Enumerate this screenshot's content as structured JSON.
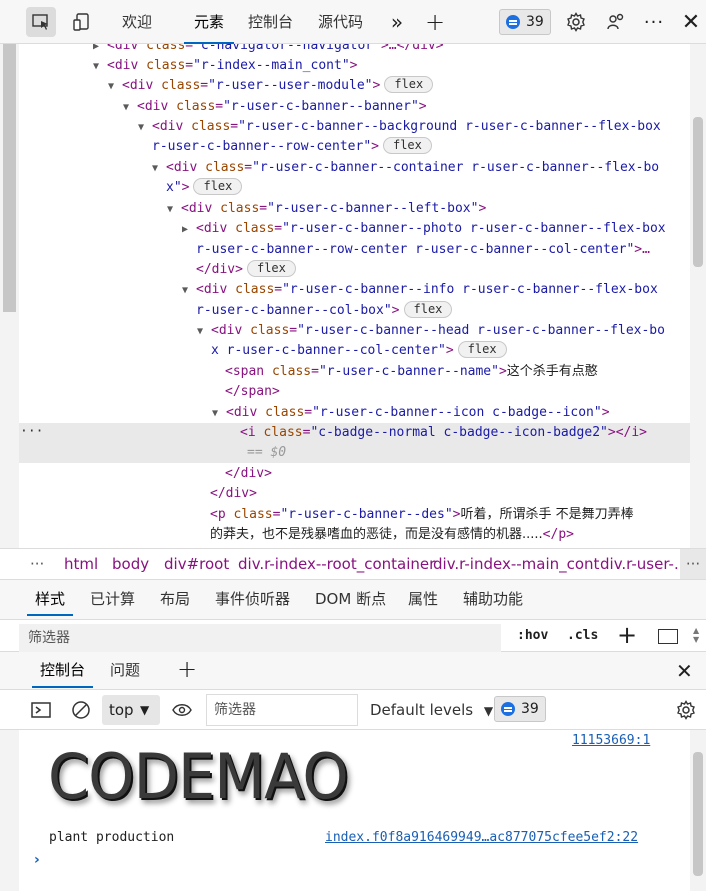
{
  "toolbar": {
    "tabs": [
      "欢迎",
      "元素",
      "控制台",
      "源代码"
    ],
    "active_tab": "元素",
    "issues_count": "39"
  },
  "dom_lines": {
    "l0": {
      "tag_open": "<div ",
      "attr": "class",
      "val": "\"c-navigator--navigator\"",
      "tail": ">…</div>"
    },
    "l1": {
      "tag_open": "<div ",
      "attr": "class",
      "val": "\"r-index--main_cont\"",
      "tail": ">"
    },
    "l2": {
      "tag_open": "<div ",
      "attr": "class",
      "val": "\"r-user--user-module\"",
      "tail": ">",
      "badge": "flex"
    },
    "l3": {
      "tag_open": "<div ",
      "attr": "class",
      "val": "\"r-user-c-banner--banner\"",
      "tail": ">"
    },
    "l4a": {
      "tag_open": "<div ",
      "attr": "class",
      "val": "\"r-user-c-banner--background r-user-c-banner--flex-box"
    },
    "l4b": {
      "val": "r-user-c-banner--row-center\"",
      "tail": ">",
      "badge": "flex"
    },
    "l5a": {
      "tag_open": "<div ",
      "attr": "class",
      "val": "\"r-user-c-banner--container r-user-c-banner--flex-bo"
    },
    "l5b": {
      "val": "x\"",
      "tail": ">",
      "badge": "flex"
    },
    "l6": {
      "tag_open": "<div ",
      "attr": "class",
      "val": "\"r-user-c-banner--left-box\"",
      "tail": ">"
    },
    "l7a": {
      "tag_open": "<div ",
      "attr": "class",
      "val": "\"r-user-c-banner--photo r-user-c-banner--flex-box"
    },
    "l7b": {
      "val": "r-user-c-banner--row-center r-user-c-banner--col-center\"",
      "tail": ">…"
    },
    "l7c": {
      "tail": "</div>",
      "badge": "flex"
    },
    "l8a": {
      "tag_open": "<div ",
      "attr": "class",
      "val": "\"r-user-c-banner--info r-user-c-banner--flex-box"
    },
    "l8b": {
      "val": "r-user-c-banner--col-box\"",
      "tail": ">",
      "badge": "flex"
    },
    "l9a": {
      "tag_open": "<div ",
      "attr": "class",
      "val": "\"r-user-c-banner--head r-user-c-banner--flex-bo"
    },
    "l9b": {
      "val": "x r-user-c-banner--col-center\"",
      "tail": ">",
      "badge": "flex"
    },
    "l10": {
      "tag_open": "<span ",
      "attr": "class",
      "val": "\"r-user-c-banner--name\"",
      "tail": ">",
      "text": "这个杀手有点憨"
    },
    "l11": {
      "tail": "</span>"
    },
    "l12": {
      "tag_open": "<div ",
      "attr": "class",
      "val": "\"r-user-c-banner--icon c-badge--icon\"",
      "tail": ">"
    },
    "l13": {
      "tag_open": "<i ",
      "attr": "class",
      "val": "\"c-badge--normal c-badge--icon-badge2\"",
      "tail": "></i>"
    },
    "l14": {
      "text": "== $0"
    },
    "l15": {
      "tail": "</div>"
    },
    "l16": {
      "tail": "</div>"
    },
    "l17a": {
      "tag_open": "<p ",
      "attr": "class",
      "val": "\"r-user-c-banner--des\"",
      "tail": ">",
      "text": "听着，所谓杀手 不是舞刀弄棒"
    },
    "l17b": {
      "text": "的莽夫，也不是残暴嗜血的恶徒，而是没有感情的机器.....",
      "tail": "</p>"
    }
  },
  "breadcrumbs": [
    "html",
    "body",
    "div#root",
    "div.r-index--root_container",
    "div.r-index--main_cont",
    "div.r-user-..."
  ],
  "styles_tabs": [
    "样式",
    "已计算",
    "布局",
    "事件侦听器",
    "DOM 断点",
    "属性",
    "辅助功能"
  ],
  "styles_filter_placeholder": "筛选器",
  "styles_toggles": {
    "hov": ":hov",
    "cls": ".cls"
  },
  "drawer": {
    "tabs": [
      "控制台",
      "问题"
    ],
    "context": "top",
    "filter_placeholder": "筛选器",
    "levels": "Default levels",
    "issues_count": "39"
  },
  "console": {
    "source1": "11153669:1",
    "logo_text": "CODEMAO",
    "log_text": "plant production",
    "source2": "index.f0f8a916469949…ac877075cfee5ef2:22",
    "prompt": "›"
  }
}
